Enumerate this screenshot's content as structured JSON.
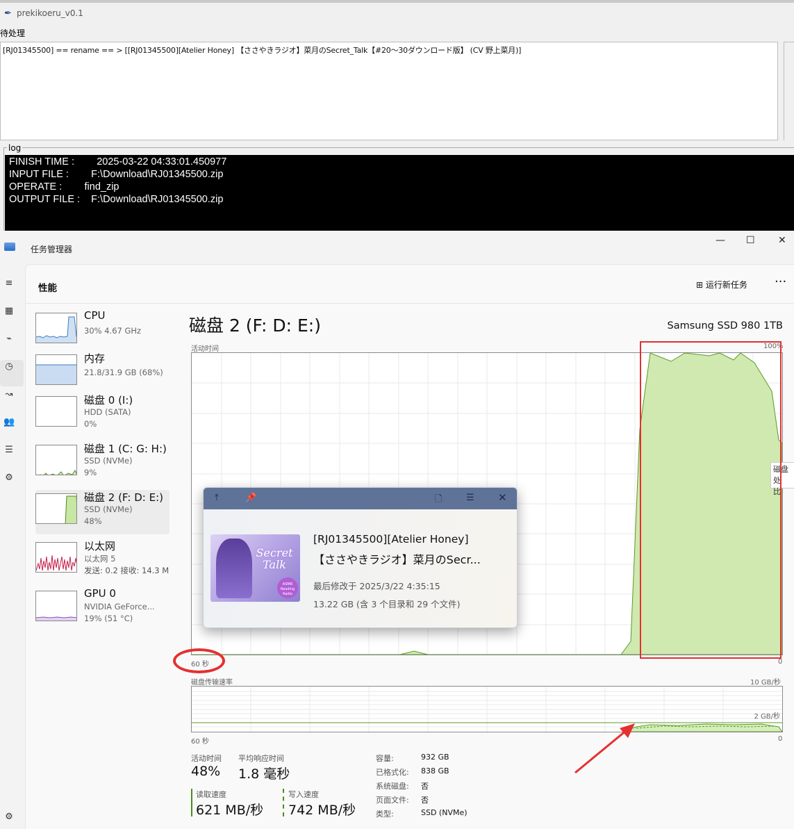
{
  "app": {
    "title": "prekikoeru_v0.1",
    "pending_label": "待处理",
    "pending_text": "[RJ01345500] == rename == > [[RJ01345500][Atelier Honey] 【ささやきラジオ】菜月のSecret_Talk【#20～30ダウンロード版】 (CV 野上菜月)]",
    "log_label": "log",
    "log_lines": [
      "FINISH TIME :        2025-03-22 04:33:01.450977",
      "INPUT FILE :        F:\\Download\\RJ01345500.zip",
      "OPERATE :        find_zip",
      "OUTPUT FILE :    F:\\Download\\RJ01345500.zip"
    ]
  },
  "taskmanager": {
    "title": "任务管理器",
    "section_title": "性能",
    "run_new_task": "运行新任务",
    "more": "···",
    "devices": [
      {
        "name": "CPU",
        "line1": "30% 4.67 GHz",
        "line2": ""
      },
      {
        "name": "内存",
        "line1": "21.8/31.9 GB (68%)",
        "line2": ""
      },
      {
        "name": "磁盘 0 (I:)",
        "line1": "HDD (SATA)",
        "line2": "0%"
      },
      {
        "name": "磁盘 1 (C: G: H:)",
        "line1": "SSD (NVMe)",
        "line2": "9%"
      },
      {
        "name": "磁盘 2 (F: D: E:)",
        "line1": "SSD (NVMe)",
        "line2": "48%"
      },
      {
        "name": "以太网",
        "line1": "以太网 5",
        "line2": "发送: 0.2  接收: 14.3 M"
      },
      {
        "name": "GPU 0",
        "line1": "NVIDIA GeForce...",
        "line2": "19% (51 °C)"
      }
    ],
    "main_title": "磁盘 2 (F: D: E:)",
    "model": "Samsung SSD 980 1TB",
    "chart1": {
      "label": "活动时间",
      "ymax": "100%",
      "x_left": "60 秒",
      "x_right": "0",
      "side_tip1": "磁盘处",
      "side_tip2": "比"
    },
    "chart2": {
      "label": "磁盘传输速率",
      "ymax": "10 GB/秒",
      "mid": "2 GB/秒",
      "x_left": "60 秒",
      "x_right": "0"
    },
    "stats": {
      "active_label": "活动时间",
      "active_value": "48%",
      "resp_label": "平均响应时间",
      "resp_value": "1.8 毫秒",
      "read_label": "读取速度",
      "read_value": "621 MB/秒",
      "write_label": "写入速度",
      "write_value": "742 MB/秒"
    },
    "props": [
      {
        "k": "容量:",
        "v": "932 GB"
      },
      {
        "k": "已格式化:",
        "v": "838 GB"
      },
      {
        "k": "系统磁盘:",
        "v": "否"
      },
      {
        "k": "页面文件:",
        "v": "否"
      },
      {
        "k": "类型:",
        "v": "SSD (NVMe)"
      }
    ]
  },
  "popup": {
    "name_line1": "[RJ01345500][Atelier Honey]",
    "name_line2": "【ささやきラジオ】菜月のSecr...",
    "modified": "最后修改于 2025/3/22 4:35:15",
    "size": "13.22 GB (含 3 个目录和 29 个文件)",
    "thumb_text": "Secret Talk",
    "thumb_badge": "ASMR Reading Radio"
  }
}
